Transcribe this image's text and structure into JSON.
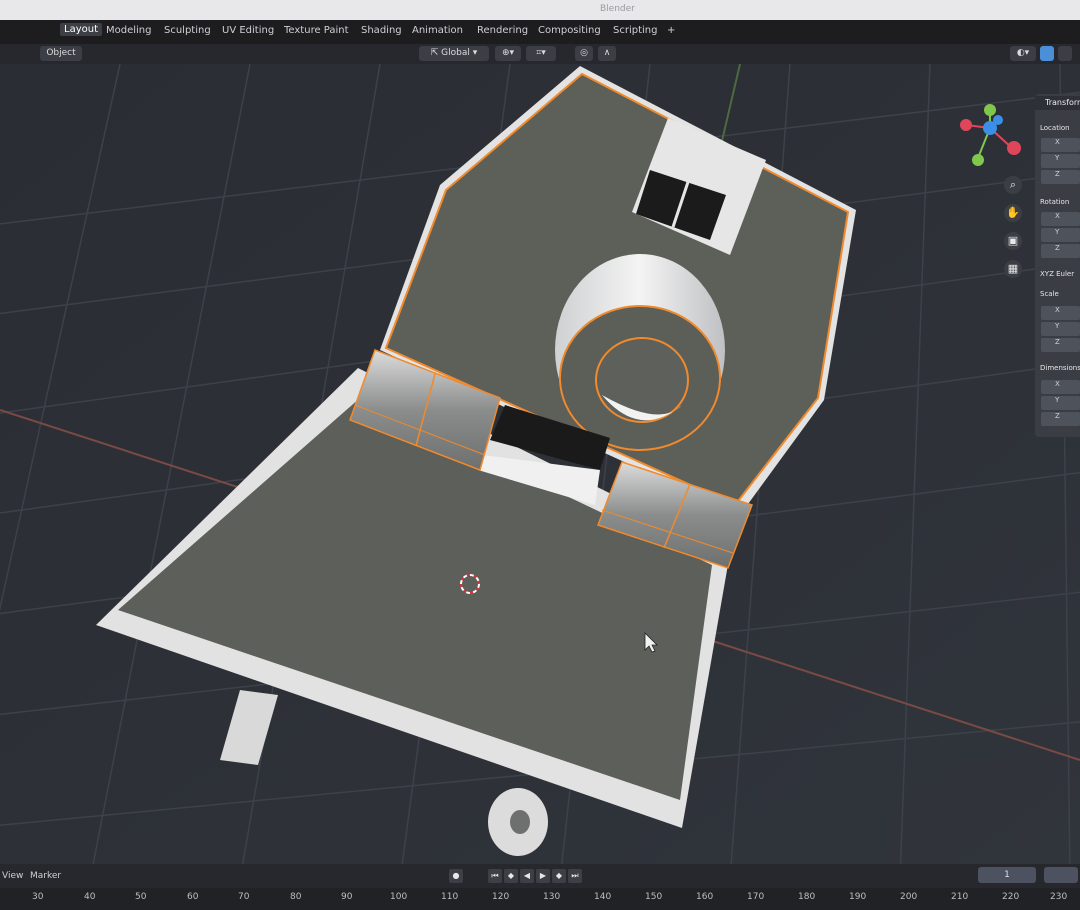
{
  "window": {
    "title": "Blender"
  },
  "menu_tabs": [
    {
      "label": "Layout",
      "active": true
    },
    {
      "label": "Modeling"
    },
    {
      "label": "Sculpting"
    },
    {
      "label": "UV Editing"
    },
    {
      "label": "Texture Paint"
    },
    {
      "label": "Shading"
    },
    {
      "label": "Animation"
    },
    {
      "label": "Rendering"
    },
    {
      "label": "Compositing"
    },
    {
      "label": "Scripting"
    },
    {
      "label": "+"
    }
  ],
  "header": {
    "transform_orientation": "Global",
    "object_mode": "Object"
  },
  "sidebar": {
    "tab": "Transform",
    "sections": [
      "Location",
      "Rotation",
      "XYZ Euler",
      "Scale",
      "Dimensions"
    ],
    "axes": [
      "X",
      "Y",
      "Z"
    ]
  },
  "timeline": {
    "view_label": "View",
    "marker_label": "Marker",
    "frame_numbers": [
      "30",
      "40",
      "50",
      "60",
      "70",
      "80",
      "90",
      "100",
      "110",
      "120",
      "130",
      "140",
      "150",
      "160",
      "170",
      "180",
      "190",
      "200",
      "210",
      "220",
      "230"
    ],
    "start_field": "1"
  },
  "colors": {
    "selection_outline": "#f08a2c",
    "grid": "#3b3f47",
    "mesh_face": "#5b5d57",
    "mesh_edge_light": "#e3e3e3",
    "sidebar_bg": "#3a3d44",
    "background": "#2c2f36"
  },
  "icons": [
    "gizmo-axes-icon",
    "zoom-icon",
    "hand-pan-icon",
    "camera-view-icon",
    "ortho-grid-icon",
    "3d-cursor-icon",
    "mouse-pointer-icon"
  ]
}
